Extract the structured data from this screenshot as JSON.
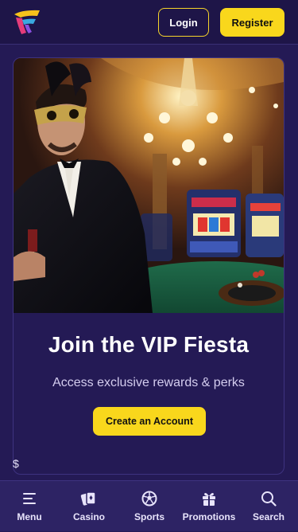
{
  "header": {
    "logo_icon": "brand-logo-icon",
    "login_label": "Login",
    "register_label": "Register"
  },
  "promo": {
    "hero_image": "masked man in tuxedo in casino with chandelier, slot machines and roulette table",
    "title": "Join the VIP Fiesta",
    "subtitle": "Access exclusive rewards & perks",
    "cta_label": "Create an Account",
    "stray_text": "$"
  },
  "bottom_nav": {
    "items": [
      {
        "label": "Menu",
        "icon": "menu-icon"
      },
      {
        "label": "Casino",
        "icon": "casino-chip-icon"
      },
      {
        "label": "Sports",
        "icon": "soccer-ball-icon"
      },
      {
        "label": "Promotions",
        "icon": "gift-icon"
      },
      {
        "label": "Search",
        "icon": "search-icon"
      }
    ]
  },
  "colors": {
    "background": "#241a55",
    "header": "#1e1548",
    "accent_yellow": "#f9d71c",
    "nav_bar": "#2d2364"
  }
}
